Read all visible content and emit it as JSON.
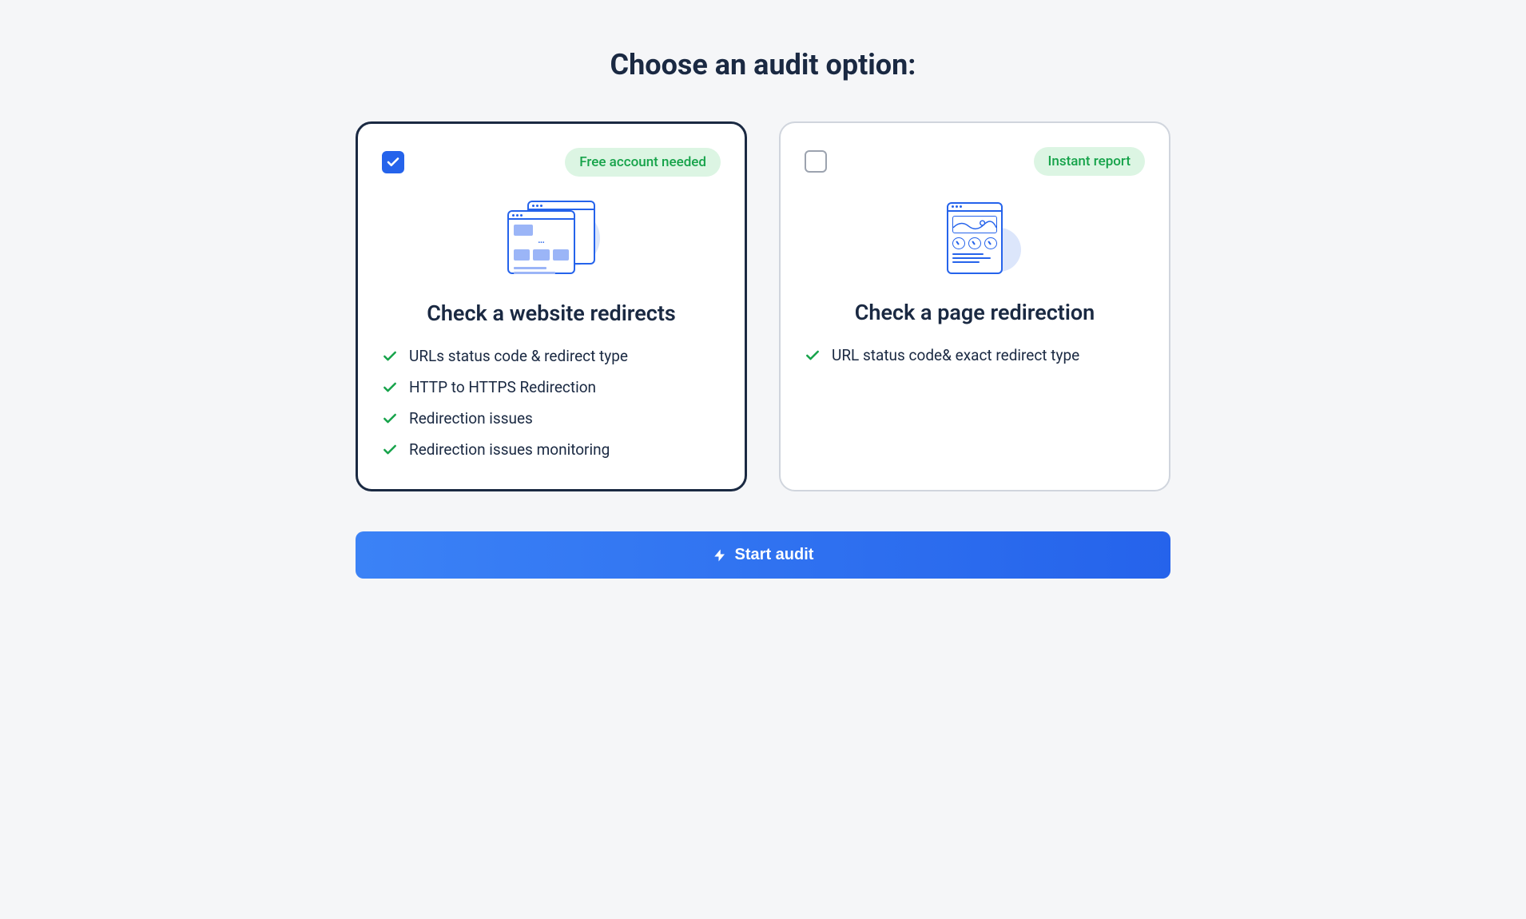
{
  "title": "Choose an audit option:",
  "options": [
    {
      "selected": true,
      "badge": "Free account needed",
      "title": "Check a website redirects",
      "features": [
        "URLs status code & redirect type",
        "HTTP to HTTPS Redirection",
        "Redirection issues",
        "Redirection issues monitoring"
      ]
    },
    {
      "selected": false,
      "badge": "Instant report",
      "title": "Check a page redirection",
      "features": [
        "URL status code& exact redirect type"
      ]
    }
  ],
  "cta": "Start audit"
}
